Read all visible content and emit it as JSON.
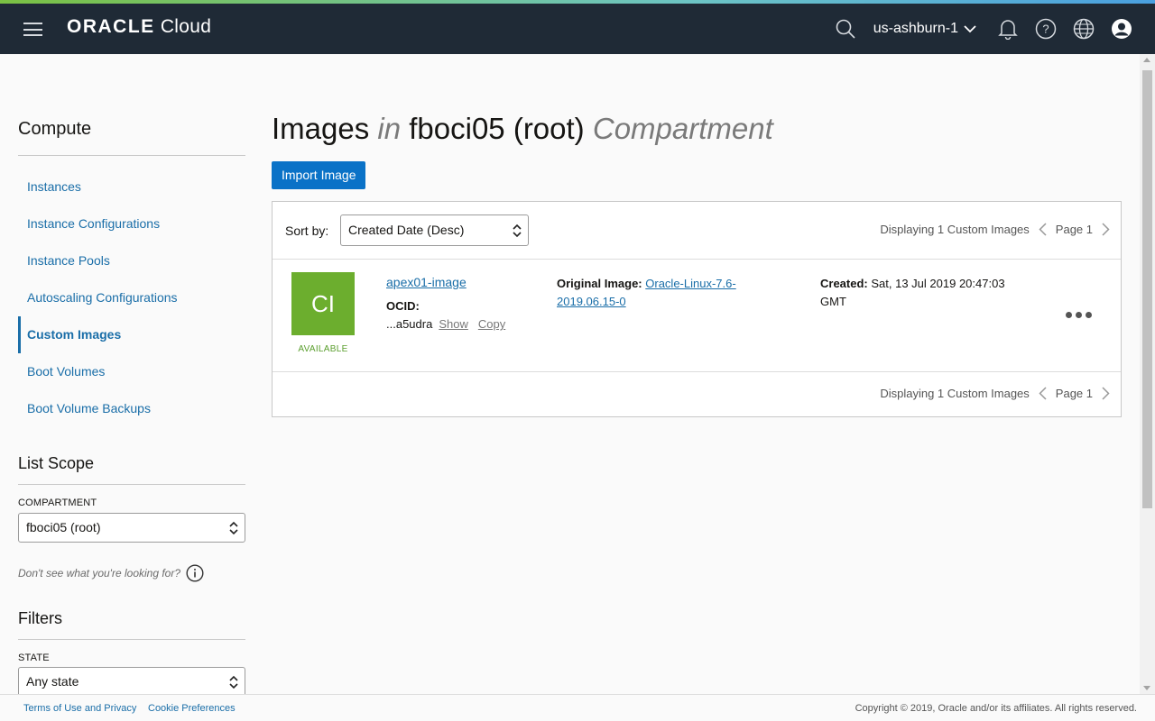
{
  "header": {
    "brand_bold": "ORACLE",
    "brand_light": "Cloud",
    "region": "us-ashburn-1",
    "icons": [
      "menu-icon",
      "search-icon",
      "chevron-down-icon",
      "bell-icon",
      "help-icon",
      "globe-icon",
      "user-icon"
    ]
  },
  "sidebar": {
    "heading": "Compute",
    "items": [
      {
        "label": "Instances"
      },
      {
        "label": "Instance Configurations"
      },
      {
        "label": "Instance Pools"
      },
      {
        "label": "Autoscaling Configurations"
      },
      {
        "label": "Custom Images",
        "active": true
      },
      {
        "label": "Boot Volumes"
      },
      {
        "label": "Boot Volume Backups"
      }
    ],
    "list_scope": {
      "heading": "List Scope",
      "compartment_label": "COMPARTMENT",
      "compartment_value": "fboci05 (root)",
      "hint": "Don't see what you're looking for?"
    },
    "filters": {
      "heading": "Filters",
      "state_label": "STATE",
      "state_value": "Any state"
    }
  },
  "main": {
    "title": {
      "part1": "Images",
      "in": "in",
      "compartment": "fboci05 (root)",
      "suffix": "Compartment"
    },
    "import_button": "Import Image",
    "sort_label": "Sort by:",
    "sort_value": "Created Date (Desc)",
    "pager_text": "Displaying 1 Custom Images",
    "page_label": "Page 1",
    "image": {
      "initials": "CI",
      "status": "AVAILABLE",
      "name": "apex01-image",
      "ocid_label": "OCID:",
      "ocid_short": "...a5udra",
      "show": "Show",
      "copy": "Copy",
      "original_label": "Original Image:",
      "original_value": "Oracle-Linux-7.6-2019.06.15-0",
      "created_label": "Created:",
      "created_value": "Sat, 13 Jul 2019 20:47:03 GMT"
    }
  },
  "footer": {
    "terms": "Terms of Use and Privacy",
    "cookies": "Cookie Preferences",
    "copyright": "Copyright © 2019, Oracle and/or its affiliates. All rights reserved."
  },
  "colors": {
    "topbar": "#1f2a36",
    "accent_blue": "#0a72c7",
    "link": "#1a6ea8",
    "image_tile": "#6cae2e"
  }
}
